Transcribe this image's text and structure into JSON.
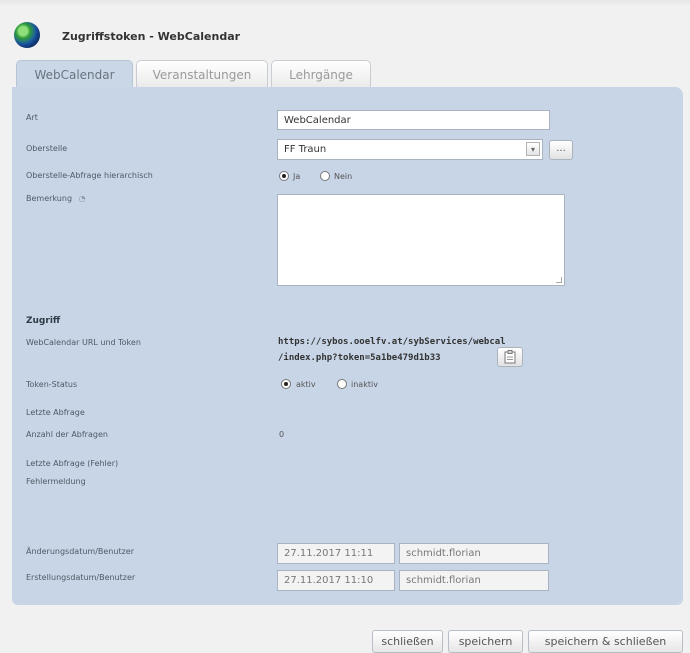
{
  "window": {
    "title": "Zugriffstoken - WebCalendar",
    "icon": "globe-icon"
  },
  "tabs": [
    {
      "label": "WebCalendar",
      "active": true
    },
    {
      "label": "Veranstaltungen",
      "active": false
    },
    {
      "label": "Lehrgänge",
      "active": false
    }
  ],
  "form": {
    "art": {
      "label": "Art",
      "value": "WebCalendar"
    },
    "oberstelle": {
      "label": "Oberstelle",
      "value": "FF Traun",
      "browse_label": "..."
    },
    "hierarchisch": {
      "label": "Oberstelle-Abfrage hierarchisch",
      "options": [
        "Ja",
        "Nein"
      ],
      "selected": "Ja"
    },
    "bemerkung": {
      "label": "Bemerkung",
      "value": ""
    }
  },
  "zugriff": {
    "heading": "Zugriff",
    "url_label": "WebCalendar URL und Token",
    "url_line1": "https://sybos.ooelfv.at/sybServices/webcal",
    "url_line2": "/index.php?token=5a1be479d1b33",
    "token_status_label": "Token-Status",
    "status_options": [
      "aktiv",
      "inaktiv"
    ],
    "status_selected": "aktiv",
    "letzte_abfrage_label": "Letzte Abfrage",
    "anzahl_label": "Anzahl der Abfragen",
    "anzahl_value": "0",
    "letzte_fehler_label": "Letzte Abfrage (Fehler)",
    "fehlermeldung_label": "Fehlermeldung"
  },
  "audit": {
    "aenderung_label": "Änderungsdatum/Benutzer",
    "aenderung_date": "27.11.2017 11:11",
    "aenderung_user": "schmidt.florian",
    "erstellung_label": "Erstellungsdatum/Benutzer",
    "erstellung_date": "27.11.2017 11:10",
    "erstellung_user": "schmidt.florian"
  },
  "footer": {
    "close_label": "schließen",
    "save_label": "speichern",
    "save_close_label": "speichern & schließen"
  }
}
